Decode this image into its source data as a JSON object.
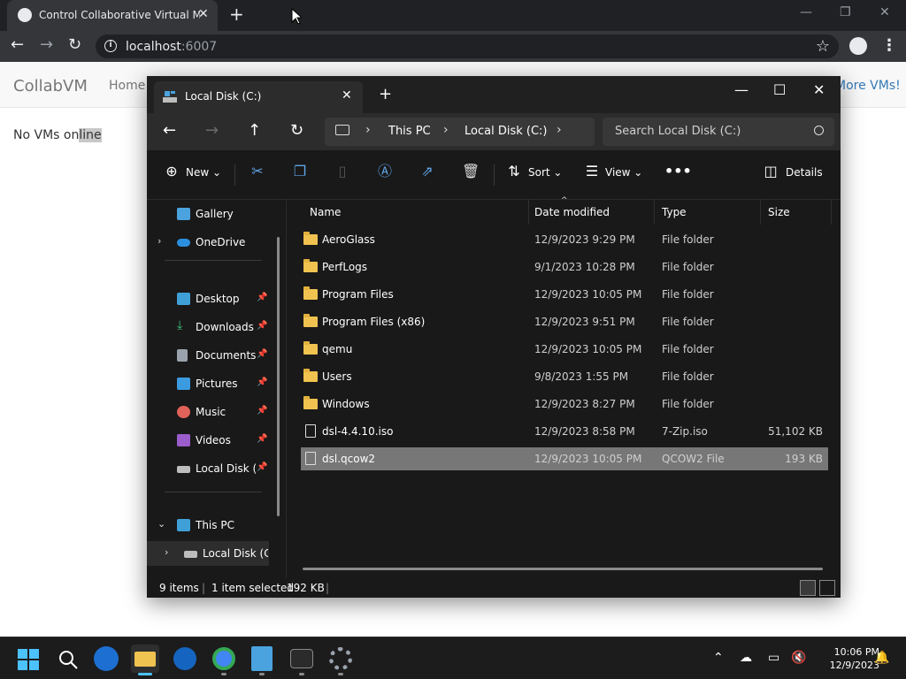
{
  "browser": {
    "tab_title": "Control Collaborative Virtual Ma",
    "url_host": "localhost",
    "url_port": ":6007"
  },
  "page": {
    "brand": "CollabVM",
    "nav_home": "Home",
    "nav_more": "More VMs!",
    "message_prefix": "No VMs on",
    "message_highlight": "line"
  },
  "explorer": {
    "tab_title": "Local Disk (C:)",
    "breadcrumbs": [
      "This PC",
      "Local Disk (C:)"
    ],
    "search_placeholder": "Search Local Disk (C:)",
    "commands": {
      "new": "New",
      "sort": "Sort",
      "view": "View",
      "details": "Details"
    },
    "sidebar": {
      "gallery": "Gallery",
      "onedrive": "OneDrive",
      "desktop": "Desktop",
      "downloads": "Downloads",
      "documents": "Documents",
      "pictures": "Pictures",
      "music": "Music",
      "videos": "Videos",
      "local_disk_pinned": "Local Disk (C",
      "this_pc": "This PC",
      "local_disk": "Local Disk (C:)"
    },
    "columns": {
      "name": "Name",
      "date": "Date modified",
      "type": "Type",
      "size": "Size"
    },
    "files": [
      {
        "name": "AeroGlass",
        "date": "12/9/2023 9:29 PM",
        "type": "File folder",
        "size": ""
      },
      {
        "name": "PerfLogs",
        "date": "9/1/2023 10:28 PM",
        "type": "File folder",
        "size": ""
      },
      {
        "name": "Program Files",
        "date": "12/9/2023 10:05 PM",
        "type": "File folder",
        "size": ""
      },
      {
        "name": "Program Files (x86)",
        "date": "12/9/2023 9:51 PM",
        "type": "File folder",
        "size": ""
      },
      {
        "name": "qemu",
        "date": "12/9/2023 10:05 PM",
        "type": "File folder",
        "size": ""
      },
      {
        "name": "Users",
        "date": "9/8/2023 1:55 PM",
        "type": "File folder",
        "size": ""
      },
      {
        "name": "Windows",
        "date": "12/9/2023 8:27 PM",
        "type": "File folder",
        "size": ""
      },
      {
        "name": "dsl-4.4.10.iso",
        "date": "12/9/2023 8:58 PM",
        "type": "7-Zip.iso",
        "size": "51,102 KB"
      },
      {
        "name": "dsl.qcow2",
        "date": "12/9/2023 10:05 PM",
        "type": "QCOW2 File",
        "size": "193 KB"
      }
    ],
    "status": {
      "items": "9 items",
      "selected": "1 item selected",
      "selected_size": "192 KB"
    }
  },
  "taskbar": {
    "time": "10:06 PM",
    "date": "12/9/2023"
  },
  "colors": {
    "explorer_bg": "#191919",
    "selection": "#777777",
    "accent": "#4cc2ff",
    "folder": "#f0c350"
  }
}
